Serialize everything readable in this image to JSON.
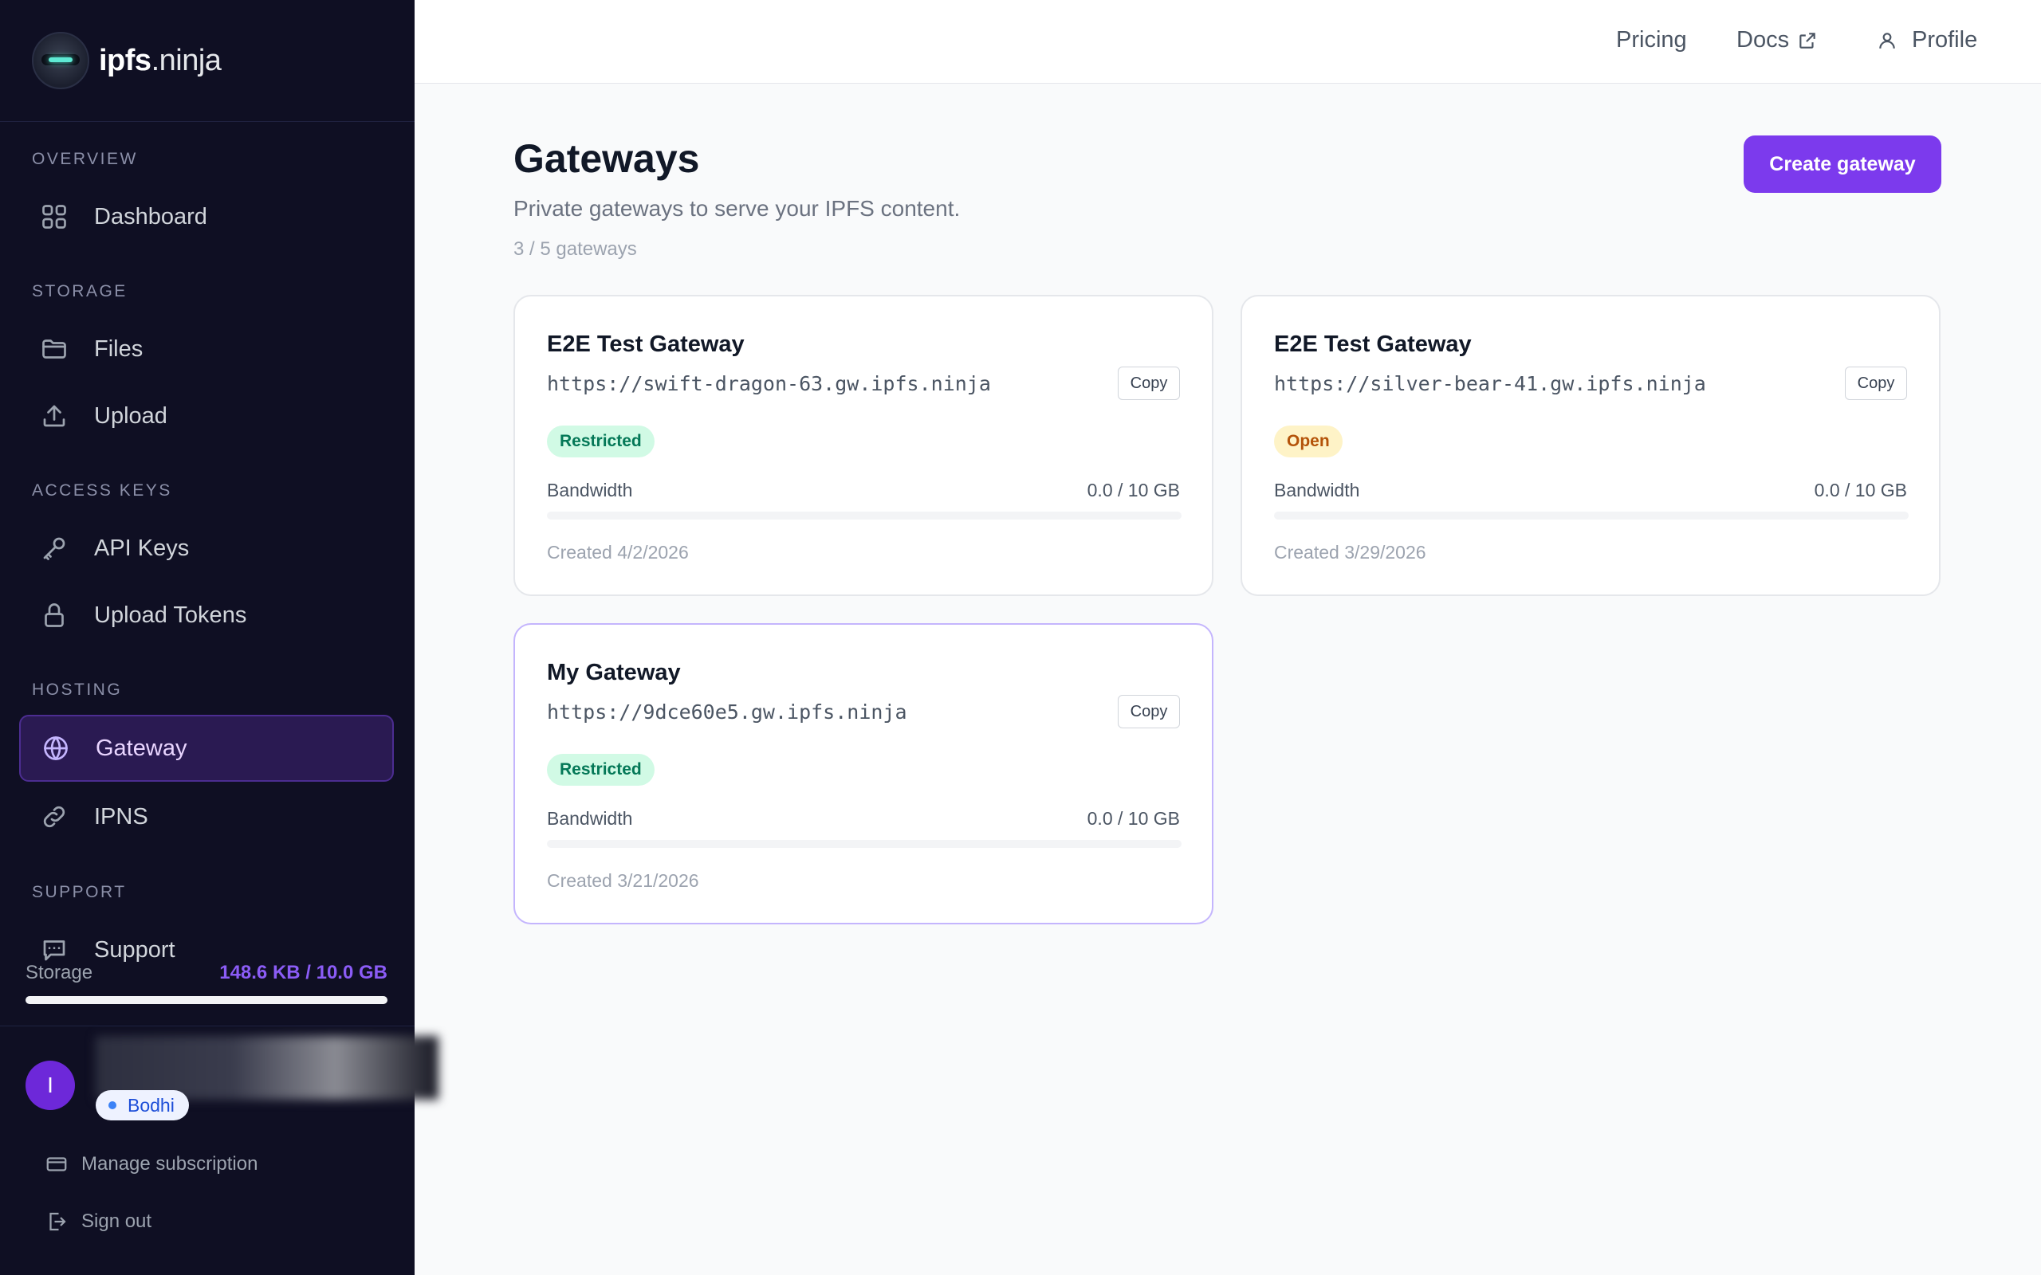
{
  "brand": {
    "bold": "ipfs",
    "rest": ".ninja"
  },
  "sidebar": {
    "sections": [
      {
        "title": "OVERVIEW"
      },
      {
        "title": "STORAGE"
      },
      {
        "title": "ACCESS KEYS"
      },
      {
        "title": "HOSTING"
      },
      {
        "title": "SUPPORT"
      }
    ],
    "items": [
      {
        "label": "Dashboard",
        "icon": "grid-icon"
      },
      {
        "label": "Files",
        "icon": "folder-icon"
      },
      {
        "label": "Upload",
        "icon": "upload-icon"
      },
      {
        "label": "API Keys",
        "icon": "key-icon"
      },
      {
        "label": "Upload Tokens",
        "icon": "lock-icon"
      },
      {
        "label": "Gateway",
        "icon": "globe-icon",
        "active": true
      },
      {
        "label": "IPNS",
        "icon": "link-icon"
      },
      {
        "label": "Support",
        "icon": "chat-icon"
      }
    ],
    "storage": {
      "label": "Storage",
      "value": "148.6 KB / 10.0 GB",
      "fraction": 1.45e-05
    },
    "user": {
      "initial": "I",
      "plan": "Bodhi"
    },
    "links": {
      "manage": "Manage subscription",
      "signout": "Sign out"
    }
  },
  "topbar": {
    "pricing": "Pricing",
    "docs": "Docs",
    "profile": "Profile"
  },
  "main": {
    "title": "Gateways",
    "subtitle": "Private gateways to serve your IPFS content.",
    "count": "3 / 5 gateways",
    "create_label": "Create gateway"
  },
  "gateways": [
    {
      "name": "E2E Test Gateway",
      "url": "https://swift-dragon-63.gw.ipfs.ninja",
      "copy": "Copy",
      "status": "Restricted",
      "bandwidth_label": "Bandwidth",
      "bandwidth": "0.0 / 10 GB",
      "bandwidth_fraction": 0,
      "created": "Created 4/2/2026"
    },
    {
      "name": "E2E Test Gateway",
      "url": "https://silver-bear-41.gw.ipfs.ninja",
      "copy": "Copy",
      "status": "Open",
      "bandwidth_label": "Bandwidth",
      "bandwidth": "0.0 / 10 GB",
      "bandwidth_fraction": 0,
      "created": "Created 3/29/2026"
    },
    {
      "name": "My Gateway",
      "url": "https://9dce60e5.gw.ipfs.ninja",
      "copy": "Copy",
      "status": "Restricted",
      "bandwidth_label": "Bandwidth",
      "bandwidth": "0.0 / 10 GB",
      "bandwidth_fraction": 0,
      "created": "Created 3/21/2026"
    }
  ],
  "colors": {
    "accent": "#7c3aed",
    "sidebar_bg": "#0f0f23",
    "restricted": "#047857",
    "open": "#b45309"
  }
}
